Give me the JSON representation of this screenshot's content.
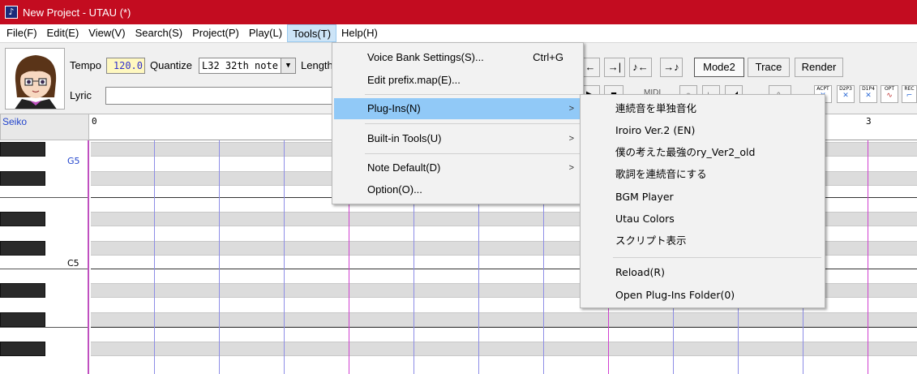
{
  "window": {
    "title": "New Project - UTAU (*)"
  },
  "menubar": [
    {
      "label": "File(F)"
    },
    {
      "label": "Edit(E)"
    },
    {
      "label": "View(V)"
    },
    {
      "label": "Search(S)"
    },
    {
      "label": "Project(P)"
    },
    {
      "label": "Play(L)"
    },
    {
      "label": "Tools(T)",
      "active": true
    },
    {
      "label": "Help(H)"
    }
  ],
  "toolbar": {
    "tempo_label": "Tempo",
    "tempo_value": "120.0",
    "quantize_label": "Quantize",
    "quantize_value": "L32 32th note",
    "length_label": "Length",
    "lyric_label": "Lyric",
    "lyric_value": "",
    "mode_button": "Mode2",
    "trace_button": "Trace",
    "render_button": "Render",
    "midi_label": "MIDI",
    "icon_labels": [
      "ACPT",
      "D2P3",
      "D1P4",
      "OPT",
      "REC"
    ]
  },
  "track": {
    "name": "Seiko"
  },
  "ruler": {
    "labels": [
      "0",
      "3"
    ]
  },
  "keys": {
    "labels": [
      "G5",
      "C5"
    ]
  },
  "tools_menu": {
    "items": [
      {
        "label": "Voice Bank Settings(S)...",
        "shortcut": "Ctrl+G"
      },
      {
        "label": "Edit prefix.map(E)..."
      },
      {
        "label": "Plug-Ins(N)",
        "submenu": true,
        "highlighted": true
      },
      {
        "label": "Built-in Tools(U)",
        "submenu": true
      },
      {
        "label": "Note Default(D)",
        "submenu": true
      },
      {
        "label": "Option(O)..."
      }
    ],
    "arrow": ">"
  },
  "plugins_menu": {
    "items": [
      {
        "label": "連続音を単独音化"
      },
      {
        "label": "Iroiro Ver.2 (EN)"
      },
      {
        "label": "僕の考えた最強のry_Ver2_old"
      },
      {
        "label": "歌詞を連続音にする"
      },
      {
        "label": "BGM Player"
      },
      {
        "label": "Utau Colors"
      },
      {
        "label": "スクリプト表示"
      },
      {
        "label": "Reload(R)"
      },
      {
        "label": "Open Plug-Ins Folder(0)"
      }
    ]
  },
  "colors": {
    "titlebar": "#c30c20",
    "menu_highlight": "#91c9f7",
    "bar_line": "#d040d0",
    "beat_line": "#8d8de6",
    "track_name": "#2244cc"
  }
}
